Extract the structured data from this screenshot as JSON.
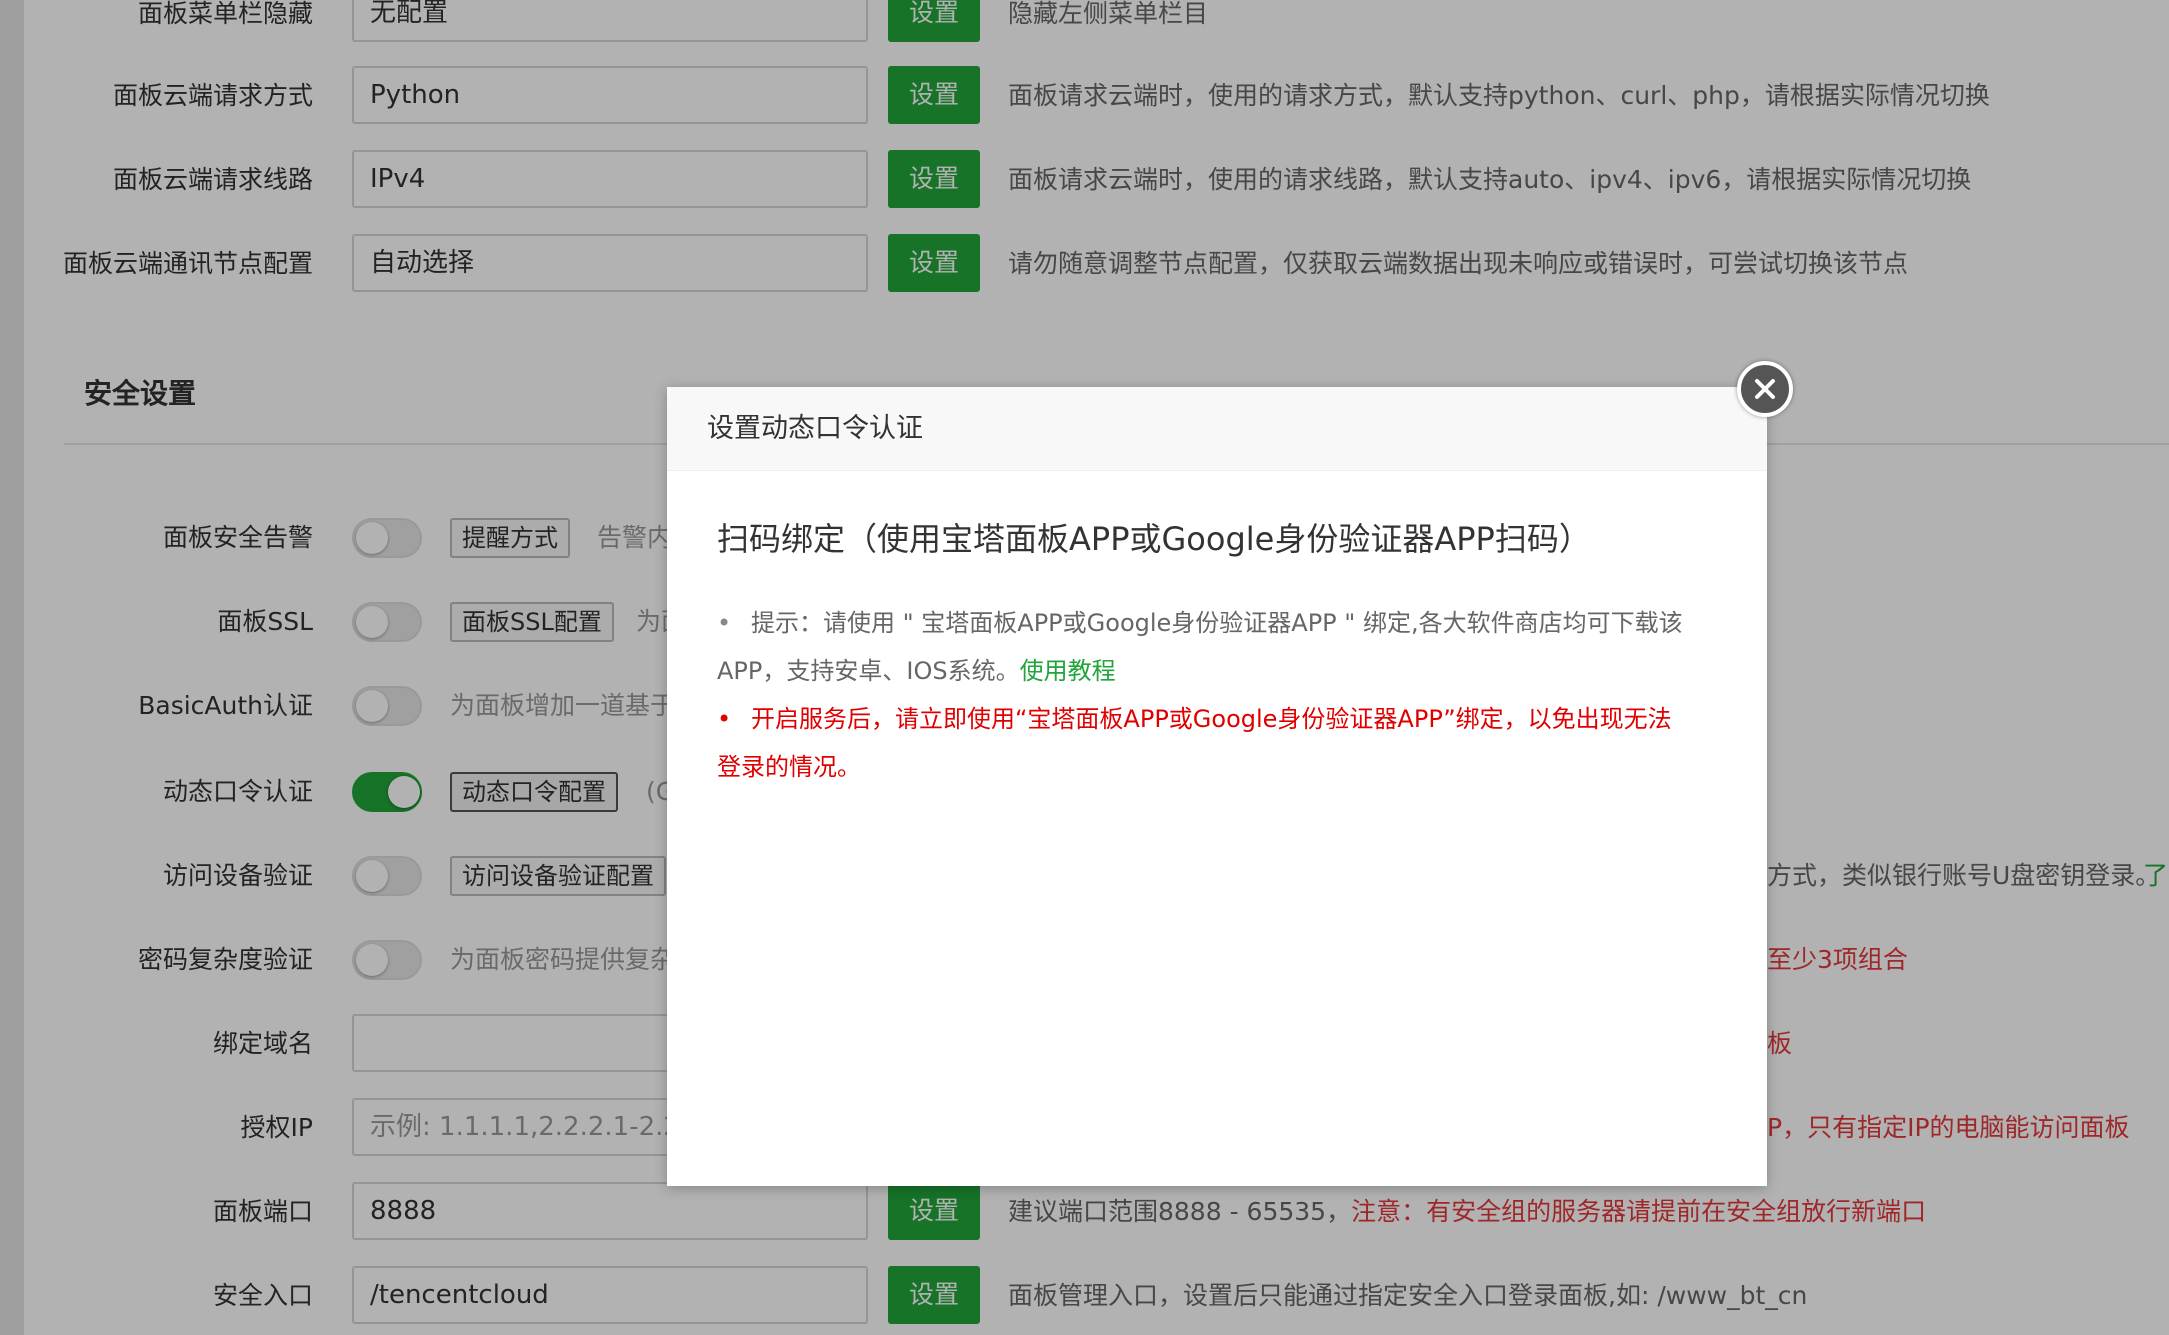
{
  "settings_top": [
    {
      "label": "面板菜单栏隐藏",
      "value": "无配置",
      "button": "设置",
      "desc": "隐藏左侧菜单栏目"
    },
    {
      "label": "面板云端请求方式",
      "value": "Python",
      "button": "设置",
      "desc": "面板请求云端时，使用的请求方式，默认支持python、curl、php，请根据实际情况切换"
    },
    {
      "label": "面板云端请求线路",
      "value": "IPv4",
      "button": "设置",
      "desc": "面板请求云端时，使用的请求线路，默认支持auto、ipv4、ipv6，请根据实际情况切换"
    },
    {
      "label": "面板云端通讯节点配置",
      "value": "自动选择",
      "button": "设置",
      "desc": "请勿随意调整节点配置，仅获取云端数据出现未响应或错误时，可尝试切换该节点"
    }
  ],
  "security": {
    "title": "安全设置",
    "alert": {
      "label": "面板安全告警",
      "button": "提醒方式",
      "after": "告警内"
    },
    "ssl": {
      "label": "面板SSL",
      "button": "面板SSL配置",
      "after": "为面"
    },
    "basicauth": {
      "label": "BasicAuth认证",
      "after": "为面板增加一道基于"
    },
    "totp": {
      "label": "动态口令认证",
      "button": "动态口令配置",
      "after": "(G"
    },
    "device": {
      "label": "访问设备验证",
      "button": "访问设备验证配置",
      "far": "方式，类似银行账号U盘密钥登录。",
      "far_link": "了"
    },
    "password": {
      "label": "密码复杂度验证",
      "after": "为面板密码提供复杂",
      "far": "至少3项组合"
    },
    "domain": {
      "label": "绑定域名",
      "far": "板"
    },
    "ip": {
      "label": "授权IP",
      "placeholder": "示例: 1.1.1.1,2.2.2.1-2.2.2.2",
      "far": "P，只有指定IP的电脑能访问面板"
    },
    "port": {
      "label": "面板端口",
      "value": "8888",
      "button": "设置",
      "desc": "建议端口范围8888 - 65535，",
      "warn": "注意：有安全组的服务器请提前在安全组放行新端口"
    },
    "entry": {
      "label": "安全入口",
      "value": "/tencentcloud",
      "button": "设置",
      "desc": "面板管理入口，设置后只能通过指定安全入口登录面板,如: /www_bt_cn"
    }
  },
  "modal": {
    "title": "设置动态口令认证",
    "heading": "扫码绑定（使用宝塔面板APP或Google身份验证器APP扫码）",
    "tip_line1": "提示：请使用 \" 宝塔面板APP或Google身份验证器APP \" 绑定,各大软件商店均可下载该",
    "tip_line2": "APP，支持安卓、IOS系统。",
    "tip_link": "使用教程",
    "warn_line1": "开启服务后，请立即使用“宝塔面板APP或Google身份验证器APP”绑定，以免出现无法",
    "warn_line2": "登录的情况。"
  },
  "icons": {
    "close": "close-icon"
  },
  "colors": {
    "accent": "#20a53a",
    "warn": "#e4393c"
  }
}
